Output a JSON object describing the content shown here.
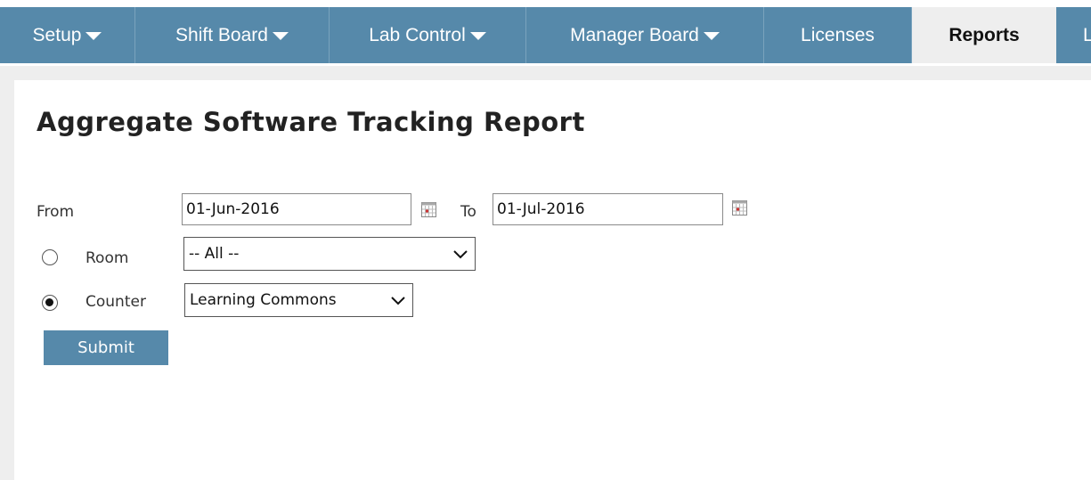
{
  "nav": {
    "items": [
      {
        "label": "Setup",
        "has_caret": true
      },
      {
        "label": "Shift Board",
        "has_caret": true
      },
      {
        "label": "Lab Control",
        "has_caret": true
      },
      {
        "label": "Manager Board",
        "has_caret": true
      },
      {
        "label": "Licenses",
        "has_caret": false
      },
      {
        "label": "Reports",
        "has_caret": false,
        "active": true
      },
      {
        "label": "L",
        "has_caret": false,
        "partial": true
      }
    ],
    "bar_color": "#5689aa",
    "active_bg": "#eeeeee"
  },
  "page": {
    "title": "Aggregate Software Tracking Report"
  },
  "form": {
    "from_label": "From",
    "from_value": "01-Jun-2016",
    "to_label": "To",
    "to_value": "01-Jul-2016",
    "calendar_icon": "calendar-icon",
    "room_label": "Room",
    "room_selected": "-- All --",
    "room_checked": false,
    "counter_label": "Counter",
    "counter_selected": "Learning Commons",
    "counter_checked": true,
    "submit_label": "Submit"
  }
}
